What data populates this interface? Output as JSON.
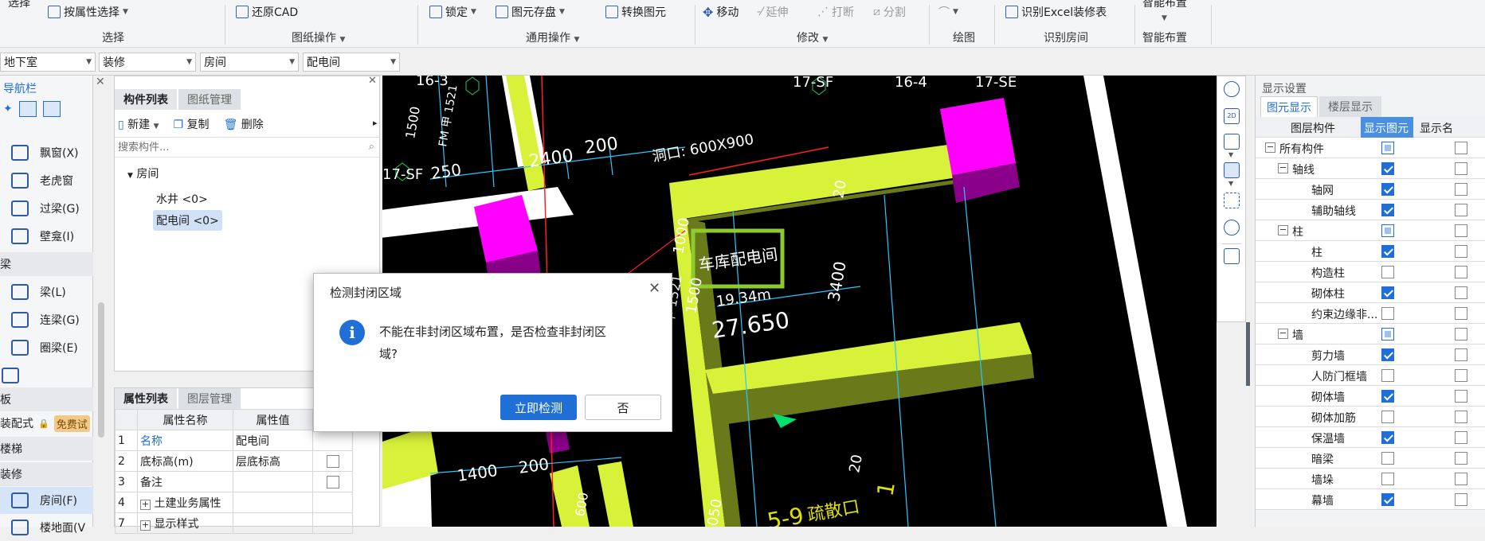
{
  "ribbon": {
    "top_partial_left": "选择",
    "select_by_attr": "按属性选择",
    "restore_cad": "还原CAD",
    "lock": "锁定",
    "save_element": "图元存盘",
    "convert_element": "转换图元",
    "move": "移动",
    "extend": "延伸",
    "break": "打断",
    "split": "分割",
    "identify_excel": "识别Excel装修表",
    "smart_place_top": "智能布置",
    "groups": {
      "select": "选择",
      "drawing_ops": "图纸操作",
      "common_ops": "通用操作",
      "modify": "修改",
      "draw": "绘图",
      "identify_room": "识别房间",
      "smart_place": "智能布置"
    }
  },
  "selectors": [
    "地下室",
    "装修",
    "房间",
    "配电间"
  ],
  "nav": {
    "title": "导航栏",
    "items": [
      {
        "label": "飘窗(X)"
      },
      {
        "label": "老虎窗"
      },
      {
        "label": "过梁(G)"
      },
      {
        "label": "壁龛(I)"
      }
    ],
    "sec_beam": "梁",
    "beams": [
      {
        "label": "梁(L)"
      },
      {
        "label": "连梁(G)"
      },
      {
        "label": "圈梁(E)"
      }
    ],
    "sec_slab": "板",
    "prefab": "装配式",
    "free_trial": "免费试",
    "sec_stairs": "楼梯",
    "sec_decor": "装修",
    "room": "房间(F)",
    "floor": "楼地面(V"
  },
  "comp": {
    "tab_list": "构件列表",
    "tab_drawing": "图纸管理",
    "new": "新建",
    "copy": "复制",
    "delete": "删除",
    "search_placeholder": "搜索构件...",
    "tree_root": "房间",
    "tree_items": [
      "水井 <0>",
      "配电间 <0>"
    ]
  },
  "prop": {
    "tab_list": "属性列表",
    "tab_layer": "图层管理",
    "col_name": "属性名称",
    "col_value": "属性值",
    "rows": [
      {
        "n": "1",
        "name": "名称",
        "value": "配电间"
      },
      {
        "n": "2",
        "name": "底标高(m)",
        "value": "层底标高"
      },
      {
        "n": "3",
        "name": "备注",
        "value": ""
      },
      {
        "n": "4",
        "name": "土建业务属性",
        "value": ""
      },
      {
        "n": "7",
        "name": "显示样式",
        "value": ""
      }
    ]
  },
  "cad": {
    "labels": {
      "l16_3": "16-3",
      "l17_sf_top": "17-SF",
      "l16_4": "16-4",
      "l17_se": "17-SE",
      "l17_sf_left": "17-SF",
      "d1500": "1500",
      "fm": "FM 甲 1521",
      "d2400": "2400",
      "d200": "200",
      "d250": "250",
      "opening": "洞口: 600X900",
      "d1000": "1000",
      "room_name": "车库配电间",
      "d3400": "3400",
      "fm2": "FM 甲 1521",
      "d1500b": "1500",
      "area": "19.34m",
      "elev": "27.650",
      "d1400": "1400",
      "d200b": "200",
      "d600": "600",
      "d20": "20",
      "d050": "050",
      "d1": "1",
      "d59": "5-9",
      "shaft": "疏散口",
      "d20b": "20",
      "d00": "00"
    }
  },
  "disp": {
    "title": "显示设置",
    "tab_element": "图元显示",
    "tab_floor": "楼层显示",
    "col_layer": "图层构件",
    "col_show": "显示图元",
    "col_name": "显示名",
    "rows": [
      {
        "label": "所有构件",
        "lvl": 0,
        "exp": "−",
        "state": "part"
      },
      {
        "label": "轴线",
        "lvl": 1,
        "exp": "−",
        "state": "chk"
      },
      {
        "label": "轴网",
        "lvl": 2,
        "exp": "",
        "state": "chk"
      },
      {
        "label": "辅助轴线",
        "lvl": 2,
        "exp": "",
        "state": "chk"
      },
      {
        "label": "柱",
        "lvl": 1,
        "exp": "−",
        "state": "part"
      },
      {
        "label": "柱",
        "lvl": 2,
        "exp": "",
        "state": "chk"
      },
      {
        "label": "构造柱",
        "lvl": 2,
        "exp": "",
        "state": ""
      },
      {
        "label": "砌体柱",
        "lvl": 2,
        "exp": "",
        "state": "chk"
      },
      {
        "label": "约束边缘非...",
        "lvl": 2,
        "exp": "",
        "state": ""
      },
      {
        "label": "墙",
        "lvl": 1,
        "exp": "−",
        "state": "part"
      },
      {
        "label": "剪力墙",
        "lvl": 2,
        "exp": "",
        "state": "chk"
      },
      {
        "label": "人防门框墙",
        "lvl": 2,
        "exp": "",
        "state": ""
      },
      {
        "label": "砌体墙",
        "lvl": 2,
        "exp": "",
        "state": "chk"
      },
      {
        "label": "砌体加筋",
        "lvl": 2,
        "exp": "",
        "state": ""
      },
      {
        "label": "保温墙",
        "lvl": 2,
        "exp": "",
        "state": "chk"
      },
      {
        "label": "暗梁",
        "lvl": 2,
        "exp": "",
        "state": ""
      },
      {
        "label": "墙垛",
        "lvl": 2,
        "exp": "",
        "state": ""
      },
      {
        "label": "幕墙",
        "lvl": 2,
        "exp": "",
        "state": "chk"
      }
    ]
  },
  "dialog": {
    "title": "检测封闭区域",
    "message_line1": "不能在非封闭区域布置，是否检查非封闭区",
    "message_line2": "域?",
    "confirm": "立即检测",
    "cancel": "否"
  }
}
